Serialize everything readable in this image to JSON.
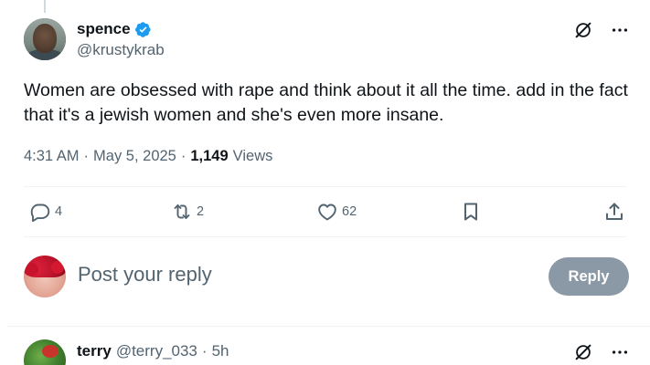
{
  "tweet": {
    "author": {
      "display_name": "spence",
      "handle": "@krustykrab",
      "verified": true
    },
    "text": "Women are obsessed with rape and think about it all the time. add in the fact that it's a jewish women and she's even more insane.",
    "time": "4:31 AM",
    "separator": "·",
    "date": "May 5, 2025",
    "views_count": "1,149",
    "views_label": "Views",
    "stats": {
      "replies": "4",
      "reposts": "2",
      "likes": "62"
    }
  },
  "composer": {
    "placeholder": "Post your reply",
    "reply_button": "Reply"
  },
  "reply": {
    "display_name": "terry",
    "handle": "@terry_033",
    "separator": "·",
    "time": "5h"
  },
  "icons": {
    "verified": "verified-badge-icon",
    "grok": "grok-icon",
    "more": "more-icon",
    "reply": "reply-icon",
    "repost": "repost-icon",
    "like": "heart-icon",
    "bookmark": "bookmark-icon",
    "share": "share-icon"
  },
  "colors": {
    "accent": "#1d9bf0",
    "muted_text": "#536471",
    "primary_text": "#0f1419",
    "disabled_button": "#8b98a5"
  }
}
